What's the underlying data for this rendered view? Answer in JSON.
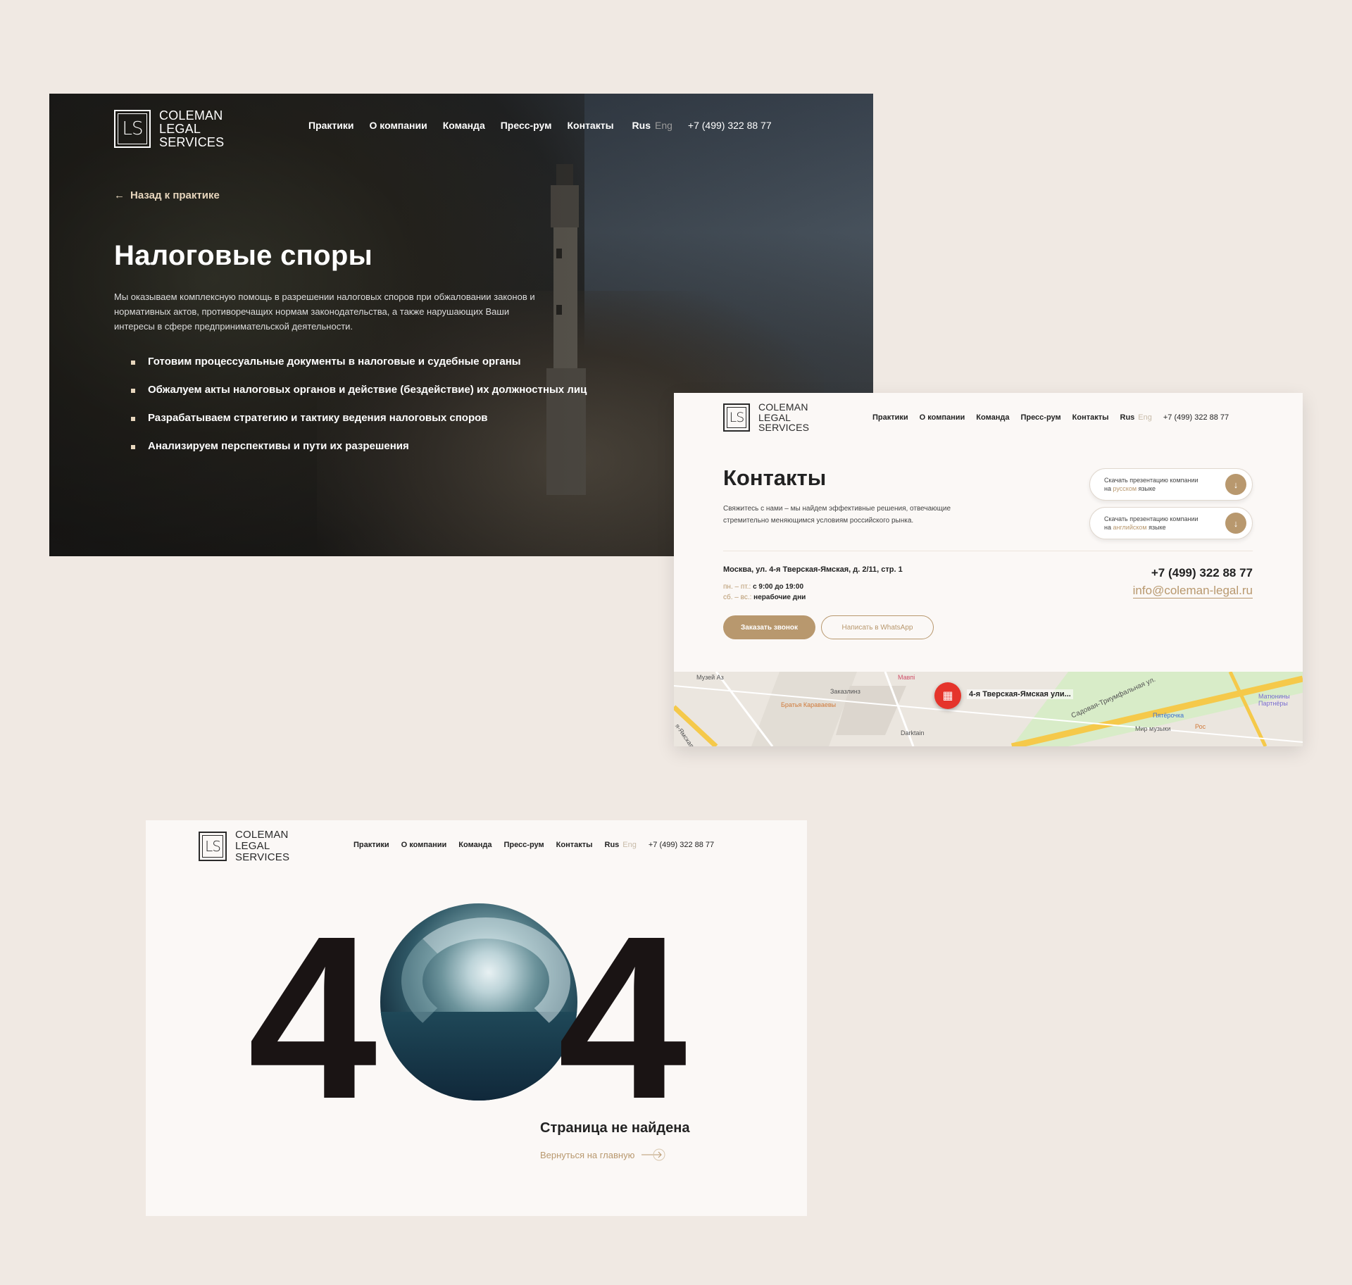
{
  "brand": {
    "lines": [
      "COLEMAN",
      "LEGAL",
      "SERVICES"
    ],
    "mark": "LS"
  },
  "nav": {
    "items": [
      "Практики",
      "О компании",
      "Команда",
      "Пресс-рум",
      "Контакты"
    ],
    "lang_active": "Rus",
    "lang_other": "Eng",
    "phone": "+7 (499) 322 88 77"
  },
  "colors": {
    "accent": "#b8986e",
    "dark": "#1a1414",
    "page_bg": "#f0e9e3",
    "card_bg": "#fbf8f6"
  },
  "practice": {
    "back_label": "Назад к практике",
    "title": "Налоговые споры",
    "lead": "Мы оказываем комплексную помощь в разрешении налоговых споров при обжаловании законов и нормативных актов, противоречащих нормам законодательства, а также нарушающих Ваши интересы в сфере предпринимательской деятельности.",
    "bullets": [
      "Готовим процессуальные документы в налоговые и судебные органы",
      "Обжалуем акты налоговых органов и действие (бездействие) их должностных лиц",
      "Разрабатываем стратегию и тактику ведения налоговых споров",
      "Анализируем перспективы и пути их разрешения"
    ]
  },
  "contacts": {
    "title": "Контакты",
    "subtitle": "Свяжитесь с нами – мы найдем эффективные решения, отвечающие стремительно меняющимся условиям российского рынка.",
    "download_ru": {
      "line1": "Скачать презентацию компании",
      "pre": "на ",
      "lang": "русском",
      "post": " языке"
    },
    "download_en": {
      "line1": "Скачать презентацию компании",
      "pre": "на ",
      "lang": "английском",
      "post": " языке"
    },
    "address": "Москва, ул. 4-я Тверская-Ямская, д. 2/11, стр. 1",
    "hours_weekdays_key": "пн. – пт.:",
    "hours_weekdays_val": "с 9:00 до 19:00",
    "hours_weekend_key": "сб. – вс.:",
    "hours_weekend_val": "нерабочие дни",
    "phone": "+7 (499) 322 88 77",
    "email": "info@coleman-legal.ru",
    "call_button": "Заказать звонок",
    "whatsapp_button": "Написать в WhatsApp",
    "map": {
      "pin_label": "4-я Тверская-Ямская ули...",
      "labels": [
        "Музей Аз",
        "Заказлинз",
        "Братья Караваевы",
        "Мавпі",
        "Darktain",
        "Садовая-Триумфальная ул.",
        "Пятёрочка",
        "Мир музыки",
        "Рос",
        "Матюнины Партнёры",
        "я-Ямская"
      ]
    }
  },
  "notfound": {
    "digit_left": "4",
    "digit_right": "4",
    "title": "Страница не найдена",
    "home_link": "Вернуться на главную"
  }
}
